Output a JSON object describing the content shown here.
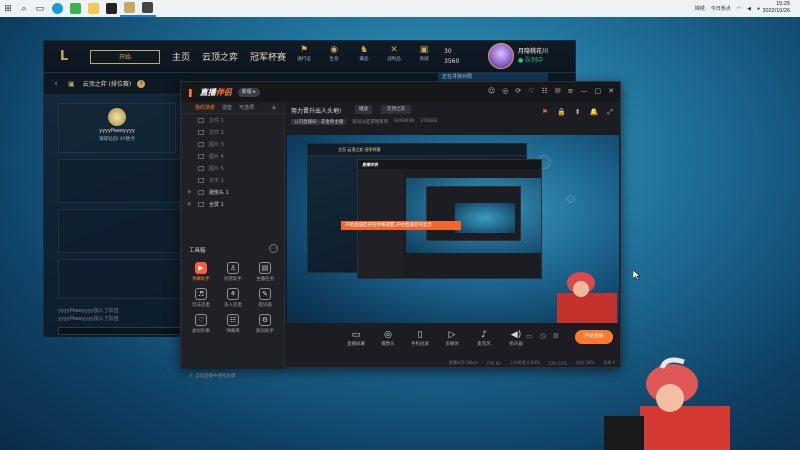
{
  "taskbar": {
    "tray_items": [
      "锦绣",
      "今日热点"
    ],
    "clock_time": "15:25",
    "clock_date": "2022/10/26"
  },
  "lol": {
    "logo": "L",
    "play_label": "开始",
    "nav": [
      "主页",
      "云顶之弈",
      "冠军杯赛"
    ],
    "icons": [
      {
        "glyph": "⚑",
        "label": "通行证"
      },
      {
        "glyph": "◉",
        "label": "生涯"
      },
      {
        "glyph": "♞",
        "label": "藏品"
      },
      {
        "glyph": "✕",
        "label": "战利品"
      },
      {
        "glyph": "▣",
        "label": "商城"
      }
    ],
    "currency_top": "30",
    "currency_bottom": "3560",
    "username": "月隐桃花川",
    "status": "● 队列中",
    "sub_mode": "云顶之弈 (排位赛)",
    "help": "?",
    "player_name": "yyyyPeeeyyyy",
    "player_rank": "璀璨钻石I 4X胜点",
    "chat_line1": "yyyyPeeeyyyy加入了队伍",
    "chat_line2": "yyyyPeeeyyyy加入了队伍",
    "blue_badge": "正在寻找对局"
  },
  "obs": {
    "logo_a": "直播",
    "logo_b": "伴侣",
    "version": "新版 ▸",
    "title_tools": [
      "☺",
      "◎",
      "⟳",
      "♡",
      "☷",
      "✉",
      "≡",
      "—",
      "▢",
      "✕"
    ],
    "tabs": [
      "我的场景",
      "混音",
      "可选项"
    ],
    "scenes": [
      {
        "eye": "",
        "label": "文件 1"
      },
      {
        "eye": "",
        "label": "文件 2"
      },
      {
        "eye": "",
        "label": "图片 3"
      },
      {
        "eye": "",
        "label": "图片 4"
      },
      {
        "eye": "",
        "label": "图片 5"
      },
      {
        "eye": "",
        "label": "文字 1"
      },
      {
        "eye": "◉",
        "label": "摄像头 1"
      },
      {
        "eye": "◉",
        "label": "全屏 1"
      }
    ],
    "toolbox_title": "工具箱",
    "tools": [
      {
        "glyph": "▶",
        "label": "弹幕助手"
      },
      {
        "glyph": "♙",
        "label": "房管助手"
      },
      {
        "glyph": "▤",
        "label": "主播任务"
      },
      {
        "glyph": "♬",
        "label": "玩法连麦"
      },
      {
        "glyph": "⚘",
        "label": "多人连麦"
      },
      {
        "glyph": "✎",
        "label": "提词器"
      },
      {
        "glyph": "♡",
        "label": "虚拟形象"
      },
      {
        "glyph": "☷",
        "label": "弹幕库"
      },
      {
        "glyph": "⚙",
        "label": "歌词助手"
      }
    ],
    "footer_left": "⓪ 当前直播中授权关键",
    "stream_title": "努力晋升出人头地!",
    "chip1": "播放",
    "chip2": "云顶之弈",
    "sub_tag": "公司直播间 · 非金牌主播",
    "sub_items": [
      "房间分区游戏系列",
      "9293030",
      "270332"
    ],
    "head_icons": [
      "⚑",
      "🔒",
      "⬆",
      "🔔",
      "⤢"
    ],
    "preview_mini_nav": "主页  云顶之弈  冠军杯赛",
    "preview_banner": "开始直播后按钮弹幕提醒,开始直播后将显示",
    "preview_mini_logo": "直播伴侣",
    "controls": [
      {
        "glyph": "▭",
        "label": "直播屏幕"
      },
      {
        "glyph": "◎",
        "label": "摄像头"
      },
      {
        "glyph": "▯",
        "label": "手机投屏"
      },
      {
        "glyph": "▷",
        "label": "多媒体"
      },
      {
        "glyph": "♪",
        "label": "麦克风"
      },
      {
        "glyph": "◀)",
        "label": "扬声器"
      }
    ],
    "side_icons": [
      "▭",
      "◷",
      "⚙"
    ],
    "go_live": "开始直播",
    "status": [
      "直播码率 0kbps",
      "FPS 60",
      "上行带宽 0.00%",
      "CPU 32%",
      "内存 58%",
      "丢帧 0"
    ]
  },
  "colors": {
    "accent": "#ff7a2e",
    "lol_gold": "#c8a95c",
    "desktop_blue": "#1f6f99"
  }
}
